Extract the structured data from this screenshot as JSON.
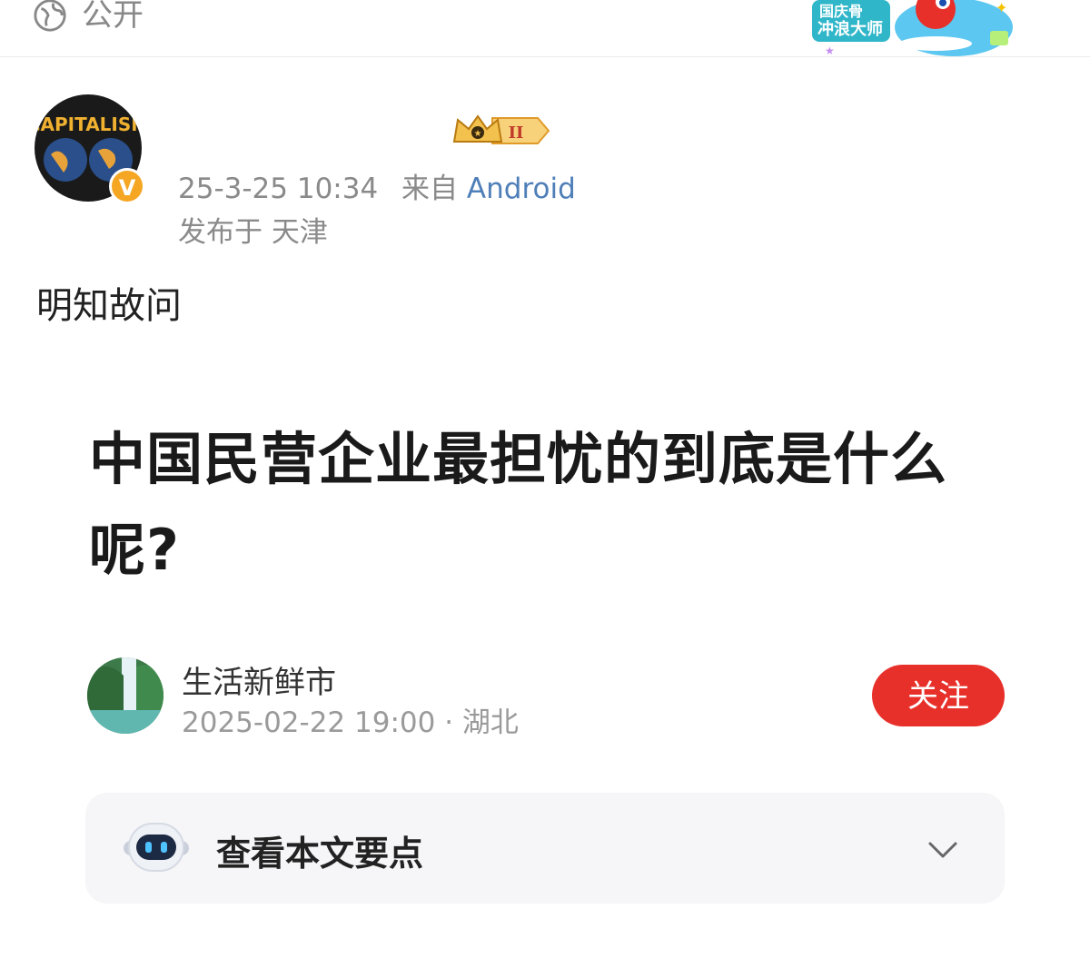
{
  "topbar": {
    "visibility_label": "公开",
    "badge_text_1": "国庆骨",
    "badge_text_2": "冲浪大师"
  },
  "post": {
    "avatar_text": "CAPITALISM",
    "verified_glyph": "V",
    "level_badge": "II",
    "time": "25-3-25 10:34",
    "source_prefix": "来自",
    "source_client": "Android",
    "location": "发布于 天津",
    "text": "明知故问"
  },
  "article": {
    "headline": "中国民营企业最担忧的到底是什么呢?",
    "author_name": "生活新鲜市",
    "author_meta": "2025-02-22 19:00 · 湖北",
    "follow_label": "关注"
  },
  "summary": {
    "label": "查看本文要点"
  },
  "colors": {
    "accent_red": "#e8302a",
    "link_blue": "#4f7fb8",
    "gold": "#f5a623"
  },
  "icons": [
    "globe-icon",
    "crown-badge-icon",
    "verified-icon",
    "robot-icon",
    "chevron-down-icon"
  ]
}
